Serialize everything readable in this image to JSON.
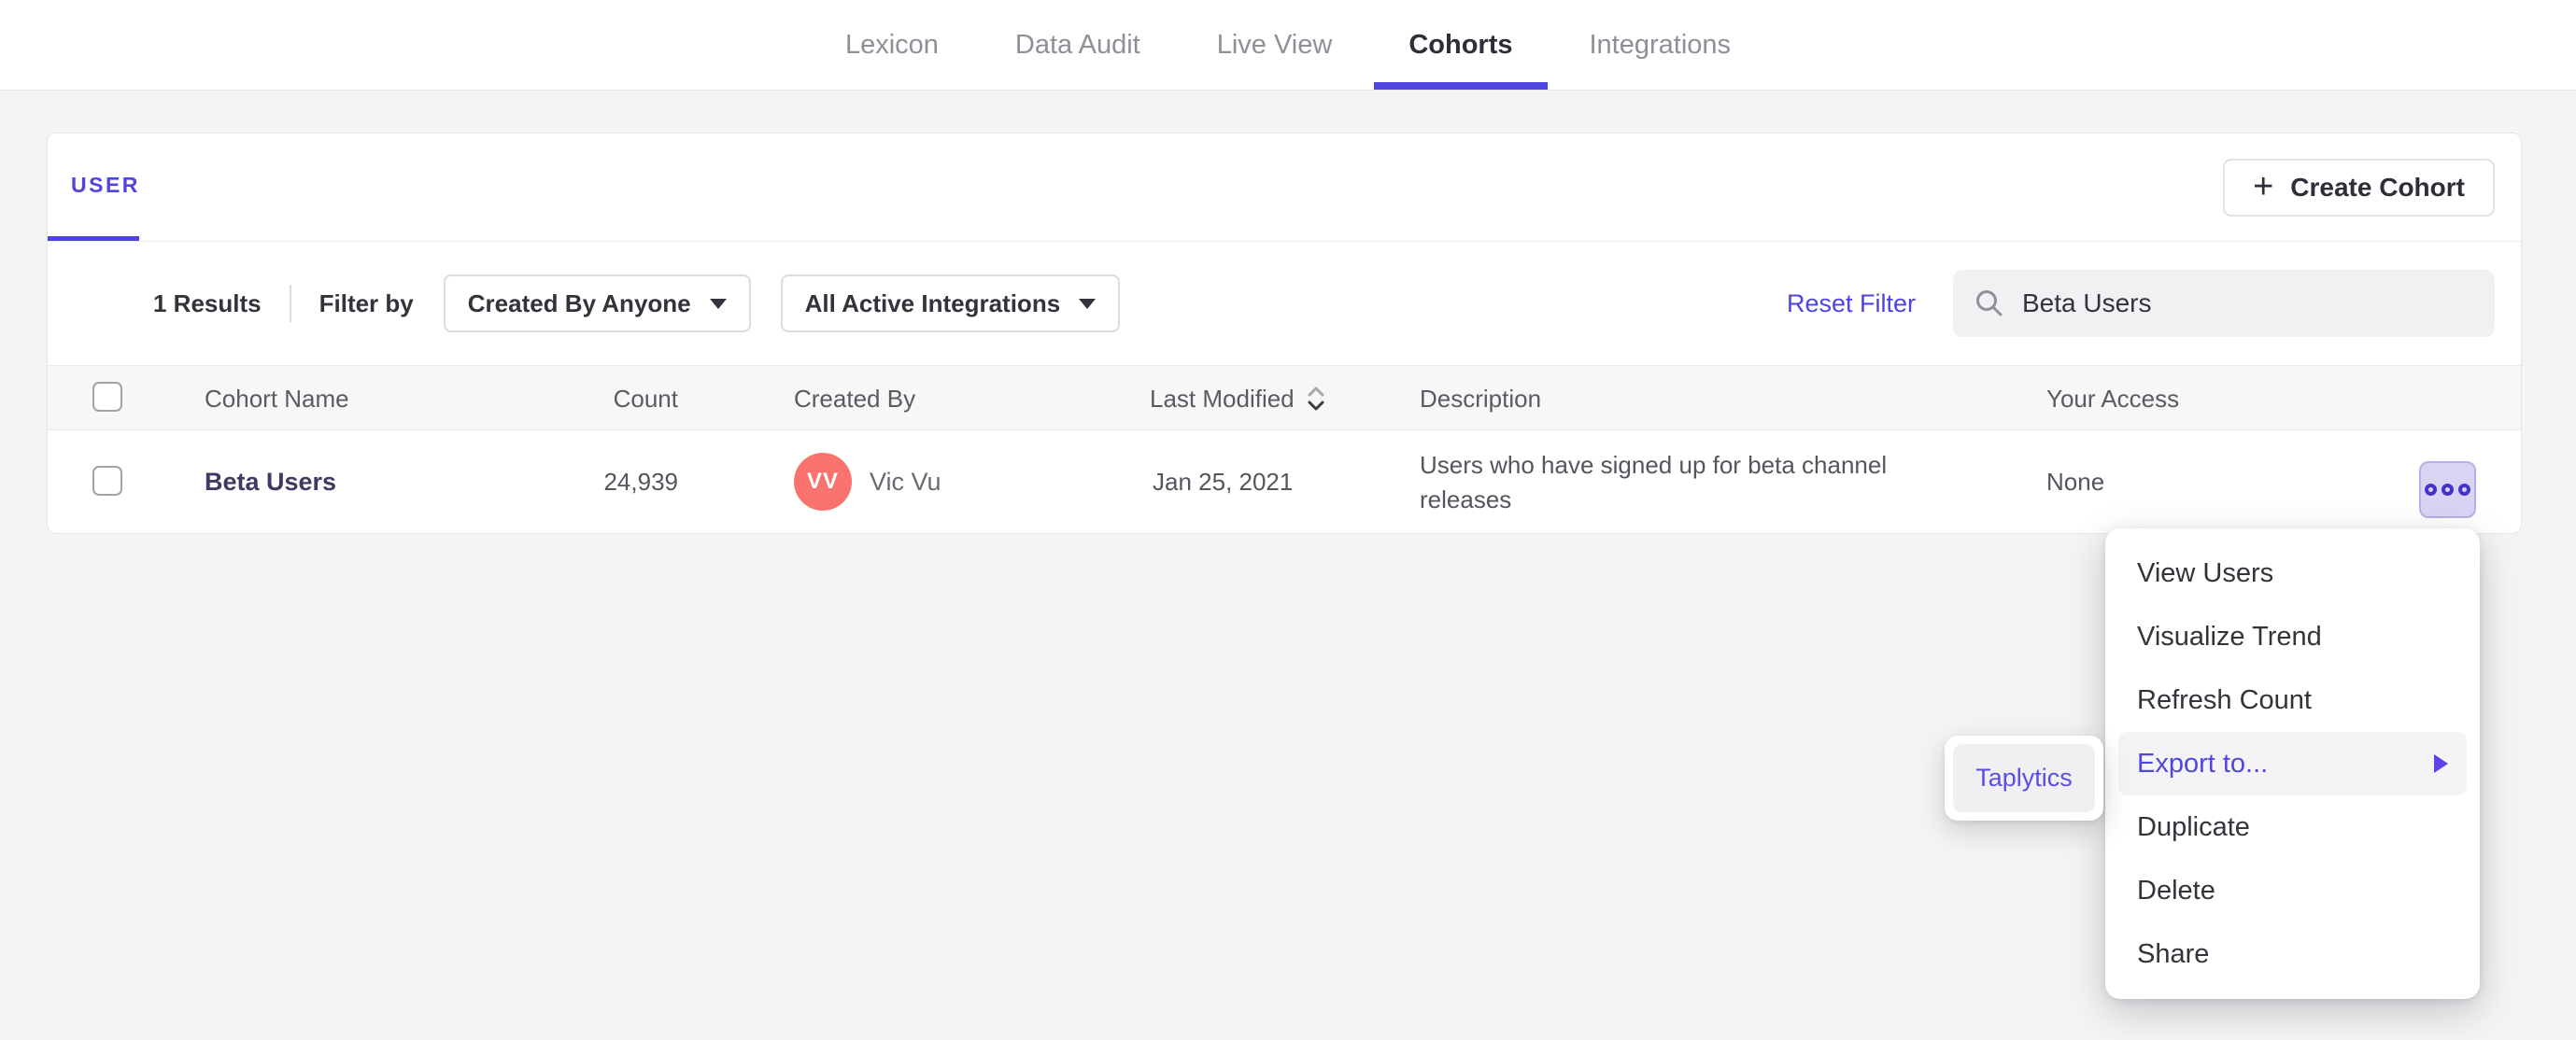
{
  "nav": {
    "tabs": [
      {
        "label": "Lexicon",
        "active": false
      },
      {
        "label": "Data Audit",
        "active": false
      },
      {
        "label": "Live View",
        "active": false
      },
      {
        "label": "Cohorts",
        "active": true
      },
      {
        "label": "Integrations",
        "active": false
      }
    ]
  },
  "cohorts_page": {
    "type_tab": "USER",
    "create_cohort_button": {
      "icon": "plus-icon",
      "label": "Create Cohort"
    },
    "filter_bar": {
      "results_count": "1 Results",
      "filter_by_label": "Filter by",
      "created_by_dropdown": "Created By Anyone",
      "integrations_dropdown": "All Active Integrations",
      "reset_filter_link": "Reset Filter",
      "search": {
        "icon": "search-icon",
        "value": "Beta Users"
      }
    },
    "table": {
      "headers": [
        "Cohort Name",
        "Count",
        "Created By",
        "Last Modified",
        "Description",
        "Your Access"
      ],
      "sort": {
        "column": "Last Modified",
        "direction": "descending"
      },
      "rows": [
        {
          "name": "Beta Users",
          "count": "24,939",
          "created_by_initials": "VV",
          "created_by": "Vic Vu",
          "last_modified": "Jan 25, 2021",
          "description": "Users who have signed up for beta channel releases",
          "your_access": "None"
        }
      ]
    }
  },
  "context_menu": {
    "items": [
      "View Users",
      "Visualize Trend",
      "Refresh Count",
      "Export to...",
      "Duplicate",
      "Delete",
      "Share"
    ],
    "highlighted_item": "Export to...",
    "submenu": {
      "items": [
        "Taplytics"
      ],
      "highlighted_item": "Taplytics"
    }
  },
  "colors": {
    "accent_purple": "#4f44e0",
    "menu_highlight_text": "#5047d9",
    "avatar_coral": "#f8736d",
    "cohort_name_link": "#3e3b63",
    "page_background": "#f4f4f5"
  }
}
